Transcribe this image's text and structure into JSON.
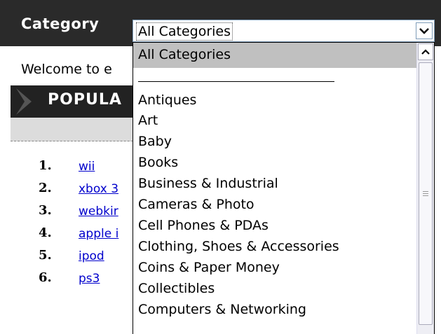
{
  "header": {
    "category_label": "Category",
    "select_value": "All Categories"
  },
  "page": {
    "welcome_text": "Welcome to e",
    "popular_title": "POPULA"
  },
  "popular_list": [
    {
      "rank": "1.",
      "term": "wii"
    },
    {
      "rank": "2.",
      "term": "xbox 3"
    },
    {
      "rank": "3.",
      "term": "webkir"
    },
    {
      "rank": "4.",
      "term": "apple i"
    },
    {
      "rank": "5.",
      "term": "ipod"
    },
    {
      "rank": "6.",
      "term": "ps3"
    }
  ],
  "dropdown": {
    "selected": "All Categories",
    "options": [
      "Antiques",
      "Art",
      "Baby",
      "Books",
      "Business & Industrial",
      "Cameras & Photo",
      "Cell Phones & PDAs",
      "Clothing, Shoes & Accessories",
      "Coins & Paper Money",
      "Collectibles",
      "Computers & Networking"
    ]
  },
  "icons": {
    "select_arrow": "chevron-down-icon",
    "scroll_up": "scroll-up-icon",
    "scroll_grip": "scroll-grip-icon",
    "popular_marker": "chevron-right-icon"
  },
  "colors": {
    "header_bg": "#2a2a2a",
    "link": "#0000cc",
    "selected_option_bg": "#c0c0c0"
  }
}
